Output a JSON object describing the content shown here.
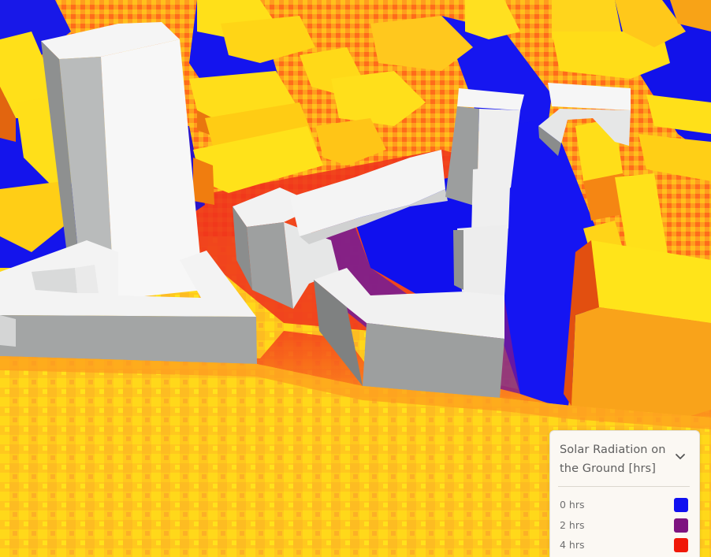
{
  "legend": {
    "title": "Solar Radiation on the Ground [hrs]",
    "expand_icon": "chevron-down-icon",
    "items": [
      {
        "label": "0 hrs",
        "color": "#1010f0"
      },
      {
        "label": "2 hrs",
        "color": "#7e1480"
      },
      {
        "label": "4 hrs",
        "color": "#f01808"
      }
    ]
  },
  "palette": {
    "ground_bright": "#ffd21a",
    "ground_orange": "#fdb41e",
    "radiation_red": "#f3281c",
    "shadow_blue": "#1111ee",
    "building_white": "#f4f4f4",
    "building_shade": "#8a8c8c"
  }
}
